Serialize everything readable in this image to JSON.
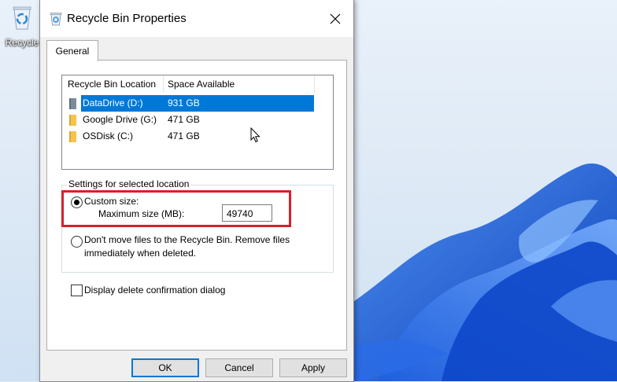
{
  "desktop": {
    "icon_label": "Recycle"
  },
  "dialog": {
    "title": "Recycle Bin Properties",
    "tabs": [
      {
        "label": "General",
        "active": true
      }
    ],
    "location_list": {
      "columns": [
        "Recycle Bin Location",
        "Space Available"
      ],
      "rows": [
        {
          "name": "DataDrive (D:)",
          "space": "931 GB",
          "selected": true
        },
        {
          "name": "Google Drive (G:)",
          "space": "471 GB",
          "selected": false
        },
        {
          "name": "OSDisk (C:)",
          "space": "471 GB",
          "selected": false
        }
      ]
    },
    "settings": {
      "legend": "Settings for selected location",
      "custom_size_label": "Custom size:",
      "custom_size_selected": true,
      "max_size_label": "Maximum size (MB):",
      "max_size_value": "49740",
      "dont_move_line1": "Don't move files to the Recycle Bin. Remove files",
      "dont_move_line2": "immediately when deleted.",
      "dont_move_selected": false
    },
    "confirm_dialog_label": "Display delete confirmation dialog",
    "confirm_dialog_checked": false,
    "buttons": {
      "ok": "OK",
      "cancel": "Cancel",
      "apply": "Apply"
    }
  },
  "colors": {
    "selection": "#0078d7",
    "highlight_box": "#d4202d",
    "wallpaper_blue": "#1a56d6"
  }
}
